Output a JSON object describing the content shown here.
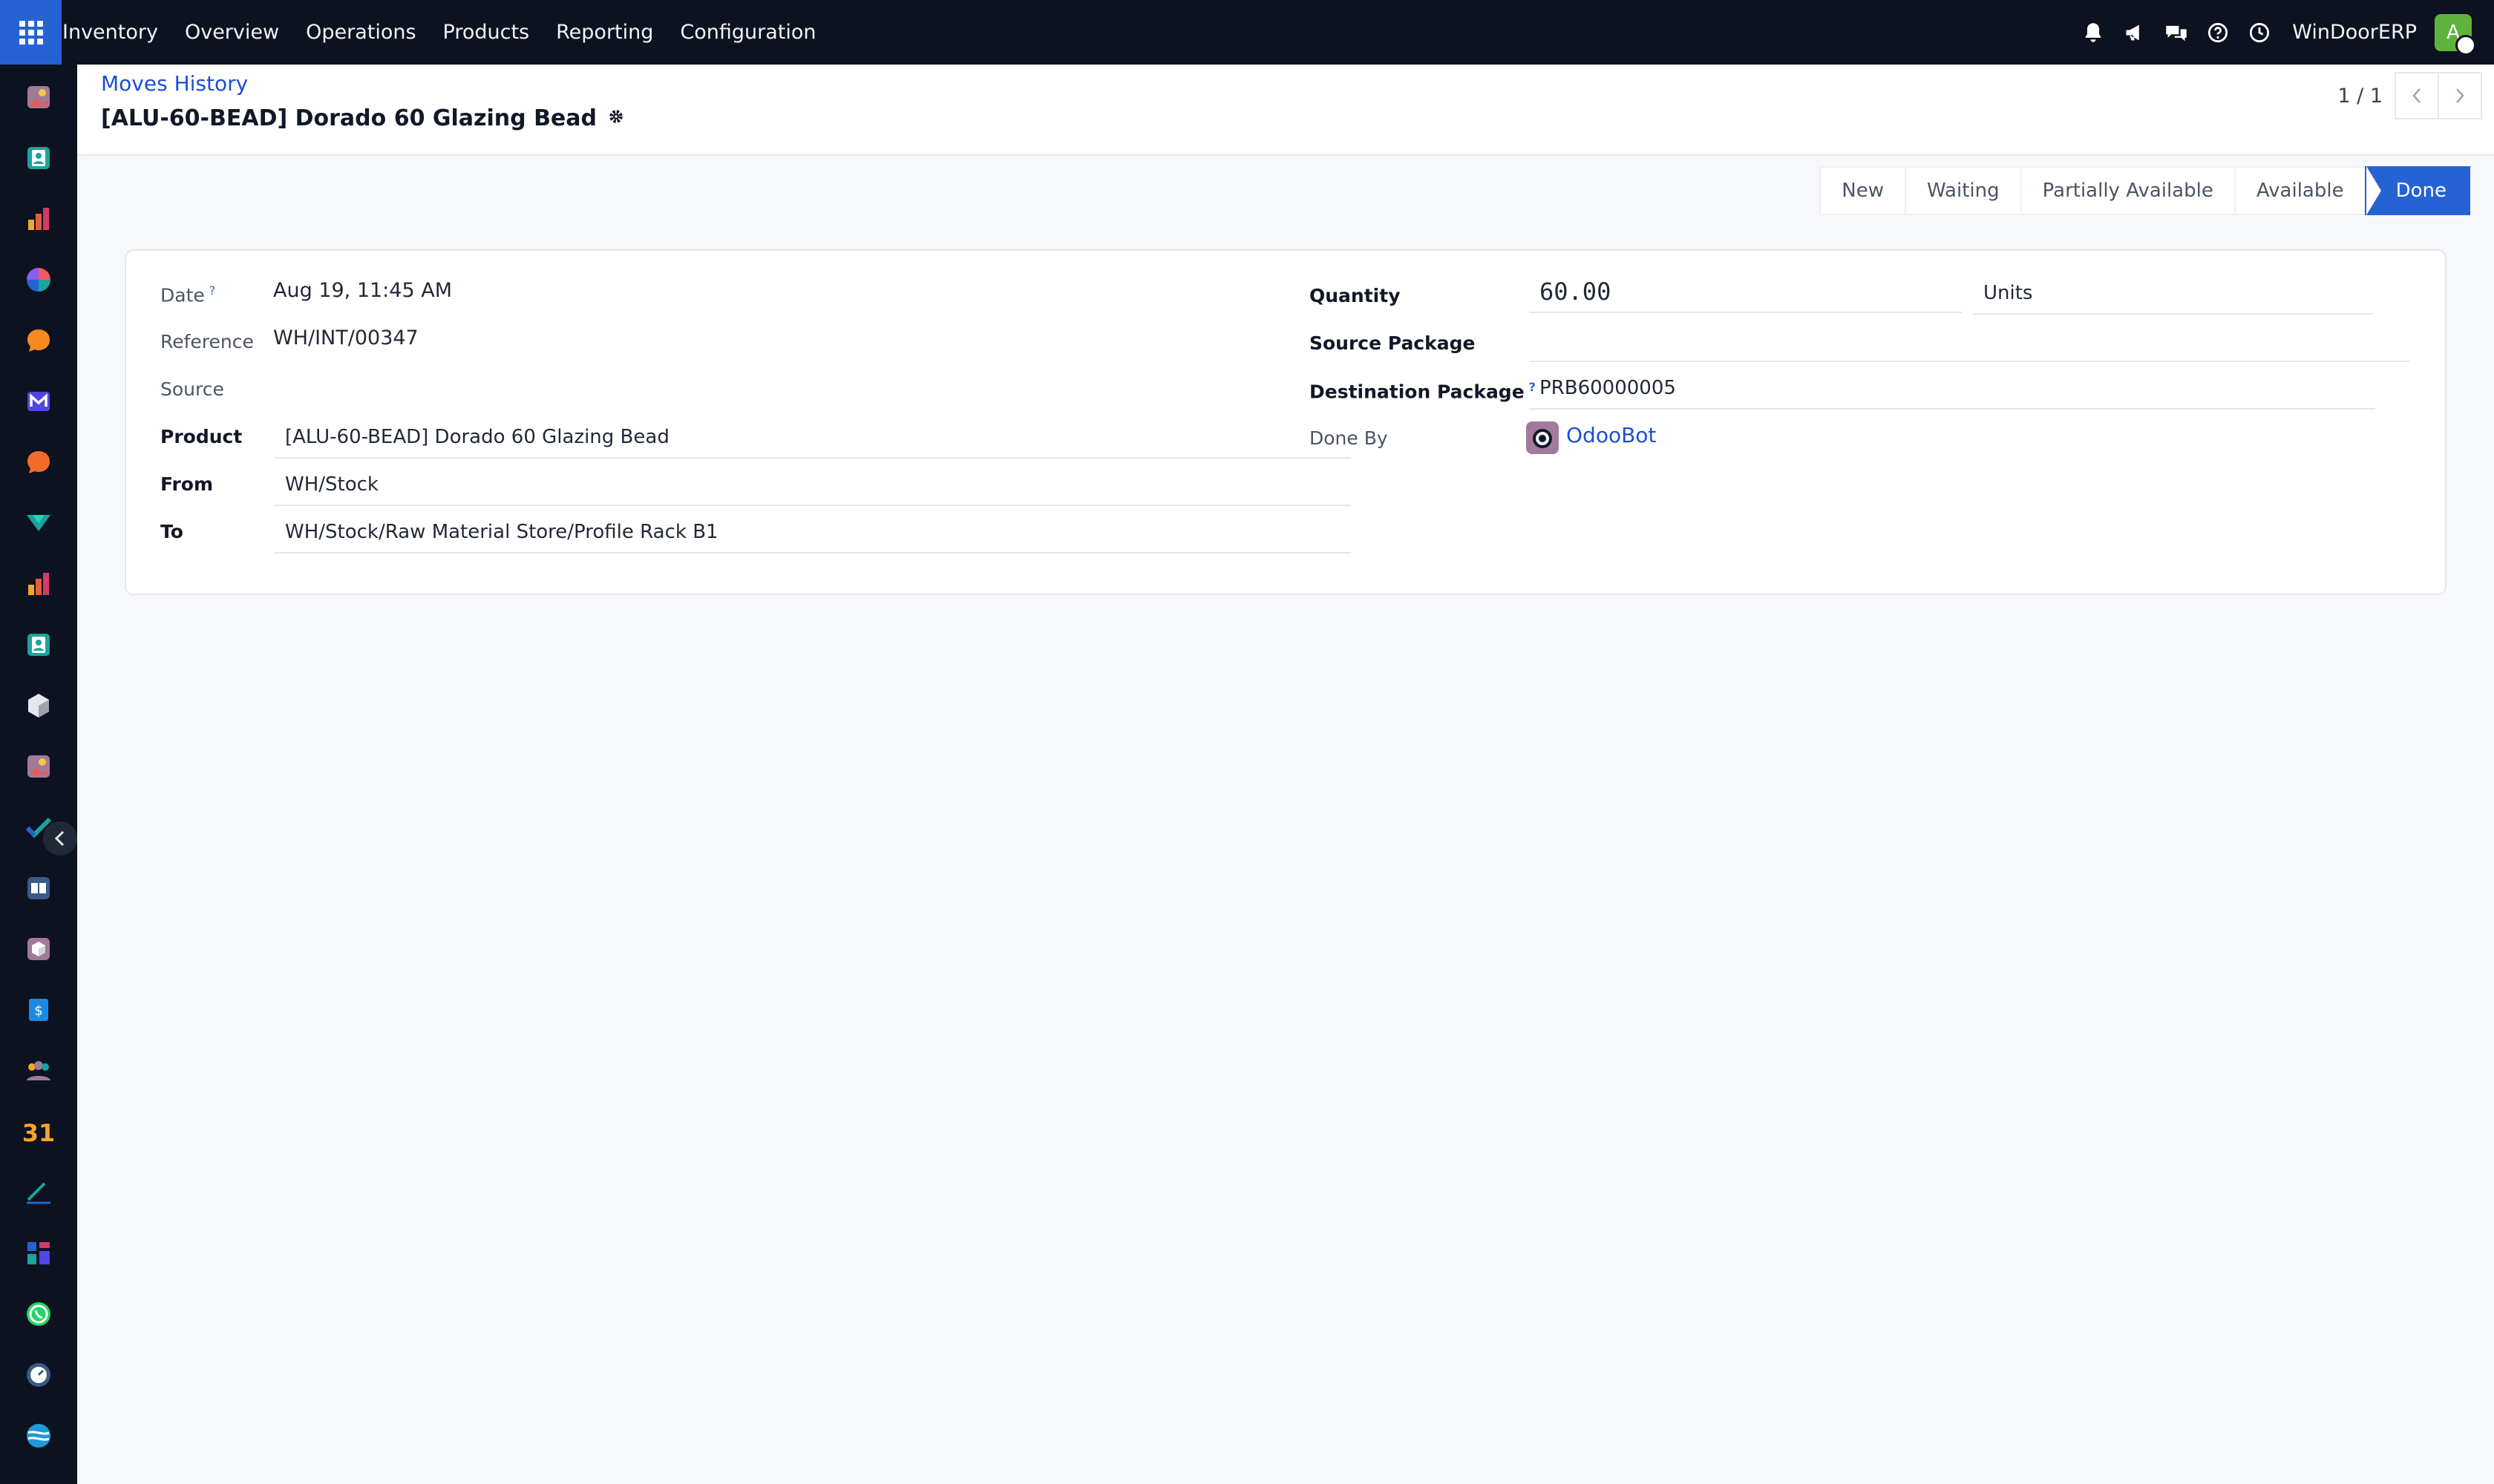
{
  "nav": {
    "menu": [
      "Inventory",
      "Overview",
      "Operations",
      "Products",
      "Reporting",
      "Configuration"
    ],
    "company": "WinDoorERP",
    "avatar_letter": "A"
  },
  "breadcrumb": "Moves History",
  "record_title": "[ALU-60-BEAD] Dorado 60 Glazing Bead",
  "pager": {
    "value": "1 / 1"
  },
  "status": {
    "stages": [
      "New",
      "Waiting",
      "Partially Available",
      "Available",
      "Done"
    ],
    "current": "Done"
  },
  "form": {
    "date_label": "Date",
    "date_value": "Aug 19, 11:45 AM",
    "reference_label": "Reference",
    "reference_value": "WH/INT/00347",
    "source_label": "Source",
    "source_value": "",
    "product_label": "Product",
    "product_value": "[ALU-60-BEAD] Dorado 60 Glazing Bead",
    "from_label": "From",
    "from_value": "WH/Stock",
    "to_label": "To",
    "to_value": "WH/Stock/Raw Material Store/Profile Rack B1",
    "quantity_label": "Quantity",
    "quantity_value": "60.00",
    "uom_value": "Units",
    "source_package_label": "Source Package",
    "source_package_value": "",
    "dest_package_label": "Destination Package",
    "dest_package_value": "PRB60000005",
    "done_by_label": "Done By",
    "done_by_value": "OdooBot",
    "help_mark": "?"
  },
  "colors": {
    "primary": "#2563d4",
    "topbar": "#0d1220",
    "link": "#1d4ed8",
    "background": "#f6f8fb"
  },
  "sidebar_icons": [
    "photo-app-icon",
    "contacts-icon",
    "dashboard-icon",
    "pie-icon",
    "chat-icon",
    "email-marketing-icon",
    "discuss-icon",
    "project-icon",
    "reporting-icon",
    "contacts-2-icon",
    "inventory-icon",
    "photo-app-2-icon",
    "todo-icon",
    "knowledge-icon",
    "inventory-3d-icon",
    "invoicing-icon",
    "employees-icon",
    "calendar-icon",
    "sign-icon",
    "apps-dashboard-icon",
    "whatsapp-icon",
    "timer-icon",
    "website-icon"
  ]
}
